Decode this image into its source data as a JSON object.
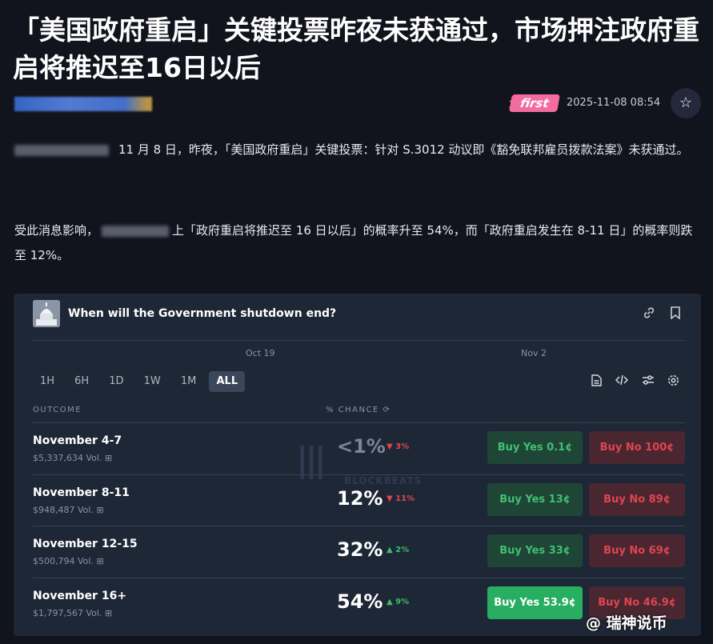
{
  "article": {
    "title": "「美国政府重启」关键投票昨夜未获通过，市场押注政府重启将推迟至16日以后",
    "badge": "first",
    "timestamp": "2025-11-08 08:54",
    "para1": "11 月 8 日，昨夜，「美国政府重启」关键投票：针对 S.3012 动议即《豁免联邦雇员拨款法案》未获通过。",
    "para2_prefix": "受此消息影响，",
    "para2_suffix": "上「政府重启将推迟至 16 日以后」的概率升至 54%，而「政府重启发生在 8-11 日」的概率则跌至 12%。"
  },
  "widget": {
    "title": "When will the Government shutdown end?",
    "chart_dates": [
      "Oct 19",
      "Nov 2"
    ],
    "range_tabs": [
      "1H",
      "6H",
      "1D",
      "1W",
      "1M",
      "ALL"
    ],
    "active_tab": "ALL",
    "col_outcome": "OUTCOME",
    "col_chance": "% CHANCE",
    "watermark": "BLOCKBEATS",
    "outcomes": [
      {
        "name": "November 4-7",
        "volume": "$5,337,634 Vol.",
        "chance": "<1%",
        "delta": "3%",
        "dir": "down",
        "yes": "Buy Yes 0.1¢",
        "no": "Buy No 100¢"
      },
      {
        "name": "November 8-11",
        "volume": "$948,487 Vol.",
        "chance": "12%",
        "delta": "11%",
        "dir": "down",
        "yes": "Buy Yes 13¢",
        "no": "Buy No 89¢"
      },
      {
        "name": "November 12-15",
        "volume": "$500,794 Vol.",
        "chance": "32%",
        "delta": "2%",
        "dir": "up",
        "yes": "Buy Yes 33¢",
        "no": "Buy No 69¢"
      },
      {
        "name": "November 16+",
        "volume": "$1,797,567 Vol.",
        "chance": "54%",
        "delta": "9%",
        "dir": "up",
        "yes": "Buy Yes 53.9¢",
        "no": "Buy No 46.9¢"
      }
    ]
  },
  "corner_watermark": "@ 瑞神说币",
  "colors": {
    "accent_green": "#27ae60",
    "accent_red": "#e0454f",
    "badge_pink": "#f36ba0"
  },
  "icons": [
    "star-icon",
    "link-icon",
    "bookmark-icon",
    "document-icon",
    "code-icon",
    "sliders-icon",
    "settings-icon",
    "refresh-icon",
    "gift-icon"
  ]
}
